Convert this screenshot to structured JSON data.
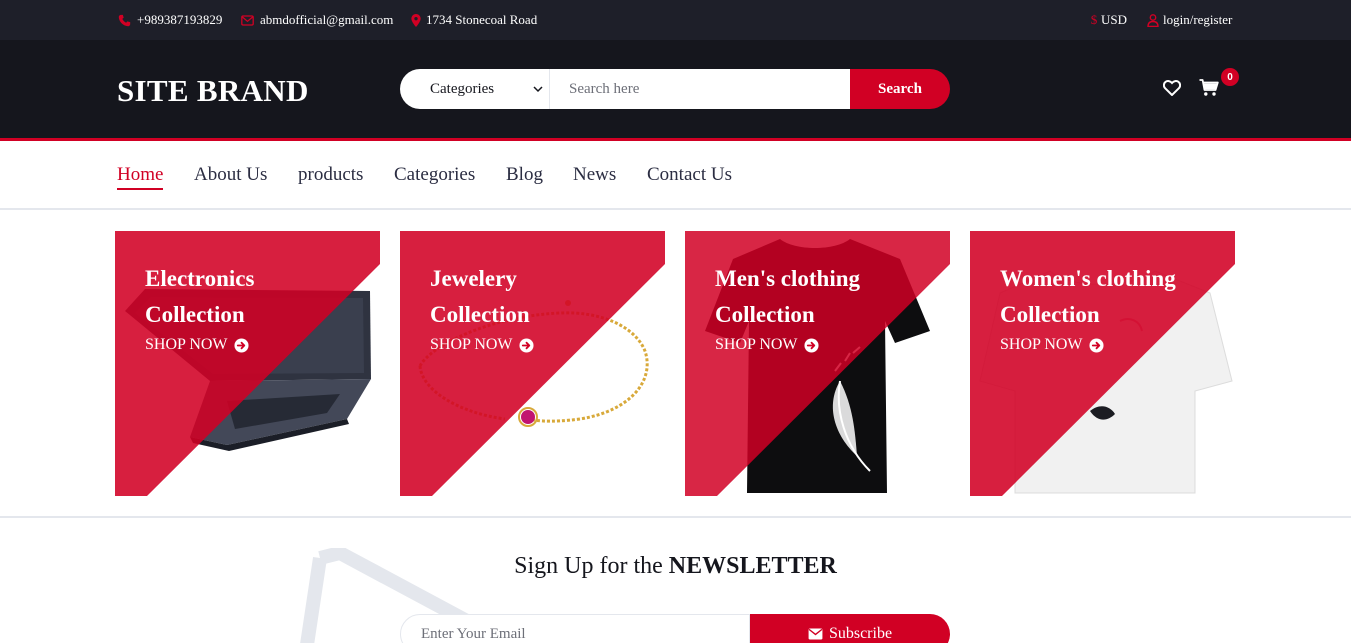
{
  "topbar": {
    "phone": "+989387193829",
    "email": "abmdofficial@gmail.com",
    "address": "1734 Stonecoal Road",
    "currency": "USD",
    "account": "login/register"
  },
  "header": {
    "brand": "SITE BRAND",
    "categories_select": "Categories",
    "search_placeholder": "Search here",
    "search_button": "Search",
    "cart_count": "0"
  },
  "nav": {
    "items": [
      {
        "label": "Home",
        "active": true
      },
      {
        "label": "About Us"
      },
      {
        "label": "products"
      },
      {
        "label": "Categories"
      },
      {
        "label": "Blog"
      },
      {
        "label": "News"
      },
      {
        "label": "Contact Us"
      }
    ]
  },
  "collections": [
    {
      "line1": "Electronics",
      "line2": "Collection",
      "cta": "SHOP NOW",
      "image": "laptop"
    },
    {
      "line1": "Jewelery",
      "line2": "Collection",
      "cta": "SHOP NOW",
      "image": "gold-bracelet"
    },
    {
      "line1": "Men's clothing",
      "line2": "Collection",
      "cta": "SHOP NOW",
      "image": "black-tshirt"
    },
    {
      "line1": "Women's clothing",
      "line2": "Collection",
      "cta": "SHOP NOW",
      "image": "white-tshirt"
    }
  ],
  "newsletter": {
    "title_prefix": "Sign Up for the",
    "title_strong": "NEWSLETTER",
    "email_placeholder": "Enter Your Email",
    "subscribe": "Subscribe"
  },
  "colors": {
    "primary": "#d10024",
    "dark": "#15161d",
    "topbar": "#1e1f29",
    "border": "#e4e7ed"
  }
}
